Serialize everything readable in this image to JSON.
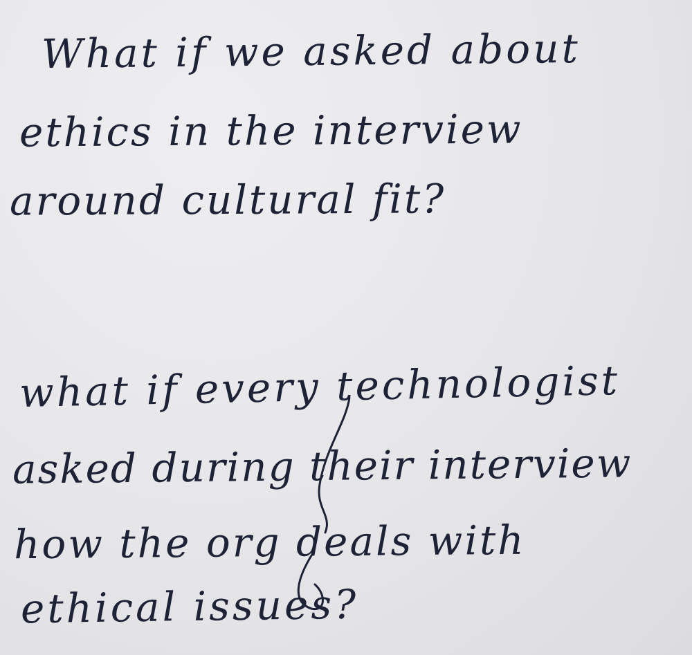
{
  "note": {
    "paragraph_1": [
      "What if we asked about",
      "ethics in the interview",
      "around cultural fit?"
    ],
    "paragraph_2": [
      "what if every technologist",
      "asked during their interview",
      "how the org deals with",
      "ethical issues?"
    ]
  },
  "colors": {
    "ink": "#1d2236",
    "paper": "#e8e8ea"
  }
}
